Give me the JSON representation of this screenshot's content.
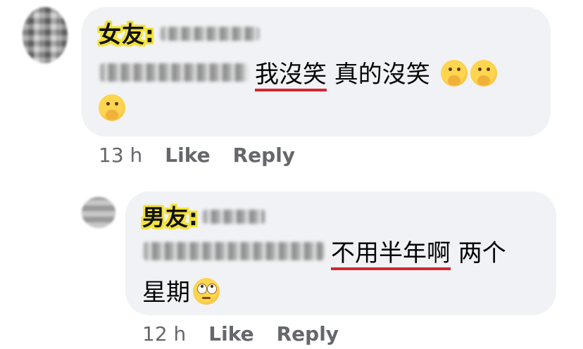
{
  "comments": [
    {
      "label": "女友:",
      "text_underlined": "我沒笑",
      "text_rest": " 真的沒笑 ",
      "emoji": "hand-over-mouth-emoji",
      "time": "13 h",
      "like_label": "Like",
      "reply_label": "Reply"
    },
    {
      "label": "男友:",
      "text_underlined": "不用半年啊",
      "text_rest": " 两个",
      "text_line2": "星期",
      "emoji": "rolling-eyes-emoji",
      "time": "12 h",
      "like_label": "Like",
      "reply_label": "Reply"
    }
  ],
  "colors": {
    "bubble": "#f0f2f5",
    "label_highlight": "#f2e23a",
    "underline": "#d6262e",
    "meta_text": "#65676b"
  }
}
